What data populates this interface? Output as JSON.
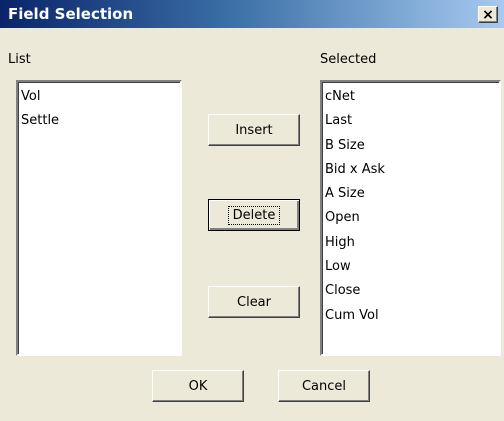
{
  "window": {
    "title": "Field Selection",
    "close_glyph": "×"
  },
  "list": {
    "label": "List",
    "items": [
      "Vol",
      "Settle"
    ]
  },
  "selected": {
    "label": "Selected",
    "items": [
      "cNet",
      "Last",
      "B Size",
      "Bid x Ask",
      "A Size",
      "Open",
      "High",
      "Low",
      "Close",
      "Cum Vol"
    ]
  },
  "buttons": {
    "insert": "Insert",
    "delete": "Delete",
    "clear": "Clear",
    "ok": "OK",
    "cancel": "Cancel"
  }
}
